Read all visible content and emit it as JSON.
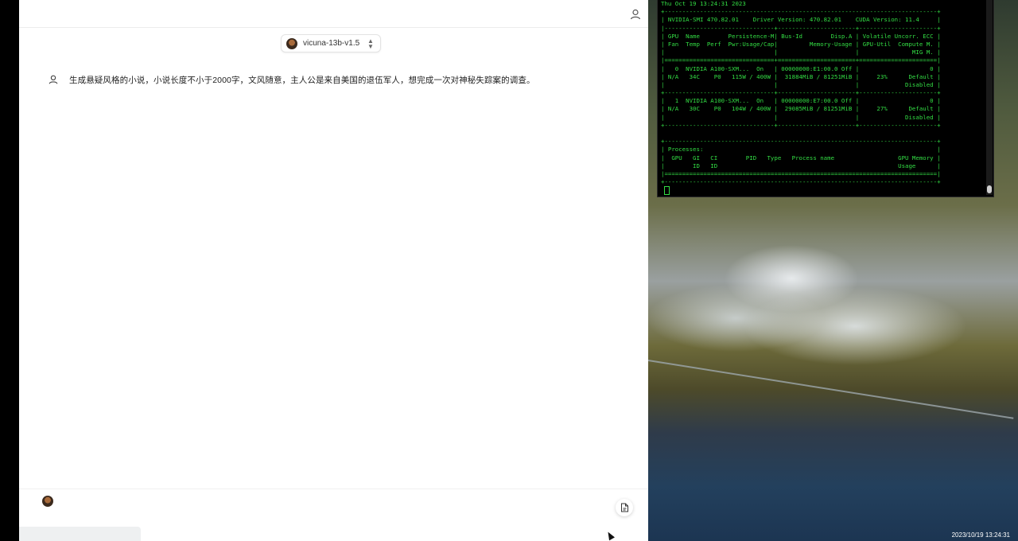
{
  "header": {
    "user_menu_icon": "user-icon"
  },
  "model_selector": {
    "name": "vicuna-13b-v1.5",
    "avatar_icon": "vicuna-avatar-icon",
    "chevron_icon": "up-down-chevron-icon"
  },
  "conversation": {
    "messages": [
      {
        "role_icon": "user-icon",
        "text": "生成悬疑风格的小说，小说长度不小于2000字，文风随意，主人公是来自美国的退伍军人，想完成一次对神秘失踪案的调查。"
      }
    ]
  },
  "composer": {
    "value": "",
    "placeholder": "",
    "attach_icon": "document-icon"
  },
  "terminal": {
    "lines": [
      "Thu Oct 19 13:24:31 2023",
      "+-----------------------------------------------------------------------------+",
      "| NVIDIA-SMI 470.82.01    Driver Version: 470.82.01    CUDA Version: 11.4     |",
      "|-------------------------------+----------------------+----------------------+",
      "| GPU  Name        Persistence-M| Bus-Id        Disp.A | Volatile Uncorr. ECC |",
      "| Fan  Temp  Perf  Pwr:Usage/Cap|         Memory-Usage | GPU-Util  Compute M. |",
      "|                               |                      |               MIG M. |",
      "|===============================+======================+======================|",
      "|   0  NVIDIA A100-SXM...  On   | 00000000:E1:00.0 Off |                    0 |",
      "| N/A   34C    P0   115W / 400W |  31884MiB / 81251MiB |     23%      Default |",
      "|                               |                      |             Disabled |",
      "+-------------------------------+----------------------+----------------------+",
      "|   1  NVIDIA A100-SXM...  On   | 00000000:E7:00.0 Off |                    0 |",
      "| N/A   30C    P0   104W / 400W |  29085MiB / 81251MiB |     27%      Default |",
      "|                               |                      |             Disabled |",
      "+-------------------------------+----------------------+----------------------+",
      "",
      "+-----------------------------------------------------------------------------+",
      "| Processes:                                                                  |",
      "|  GPU   GI   CI        PID   Type   Process name                  GPU Memory |",
      "|        ID   ID                                                   Usage      |",
      "|=============================================================================|",
      "+-----------------------------------------------------------------------------+"
    ]
  },
  "clock": {
    "datetime": "2023/10/19 13:24:31"
  }
}
